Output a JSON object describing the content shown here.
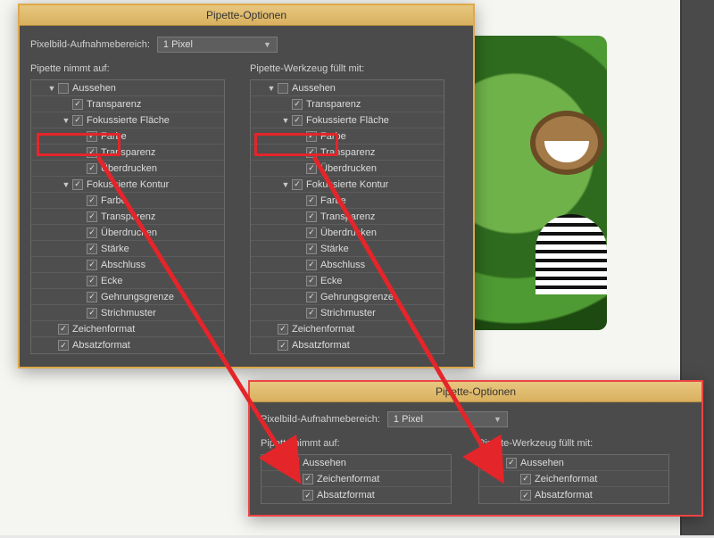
{
  "globals": {
    "title": "Pipette-Optionen",
    "pixel_label": "Pixelbild-Aufnahmebereich:",
    "pixel_value": "1 Pixel",
    "col_left_title": "Pipette nimmt auf:",
    "col_right_title": "Pipette-Werkzeug füllt mit:"
  },
  "big_tree": {
    "rows": [
      {
        "label": "Aussehen",
        "indent": 1,
        "checked": false,
        "disclosure": "down"
      },
      {
        "label": "Transparenz",
        "indent": 2,
        "checked": true
      },
      {
        "label": "Fokussierte Fläche",
        "indent": 2,
        "checked": true,
        "disclosure": "down"
      },
      {
        "label": "Farbe",
        "indent": 3,
        "checked": true
      },
      {
        "label": "Transparenz",
        "indent": 3,
        "checked": true
      },
      {
        "label": "Überdrucken",
        "indent": 3,
        "checked": true
      },
      {
        "label": "Fokussierte Kontur",
        "indent": 2,
        "checked": true,
        "disclosure": "down"
      },
      {
        "label": "Farbe",
        "indent": 3,
        "checked": true
      },
      {
        "label": "Transparenz",
        "indent": 3,
        "checked": true
      },
      {
        "label": "Überdrucken",
        "indent": 3,
        "checked": true
      },
      {
        "label": "Stärke",
        "indent": 3,
        "checked": true
      },
      {
        "label": "Abschluss",
        "indent": 3,
        "checked": true
      },
      {
        "label": "Ecke",
        "indent": 3,
        "checked": true
      },
      {
        "label": "Gehrungsgrenze",
        "indent": 3,
        "checked": true
      },
      {
        "label": "Strichmuster",
        "indent": 3,
        "checked": true
      },
      {
        "label": "Zeichenformat",
        "indent": 1,
        "checked": true
      },
      {
        "label": "Absatzformat",
        "indent": 1,
        "checked": true
      }
    ]
  },
  "small_tree": {
    "rows": [
      {
        "label": "Aussehen",
        "indent": 1,
        "checked": true,
        "disclosure": "right"
      },
      {
        "label": "Zeichenformat",
        "indent": 2,
        "checked": true
      },
      {
        "label": "Absatzformat",
        "indent": 2,
        "checked": true
      }
    ]
  }
}
